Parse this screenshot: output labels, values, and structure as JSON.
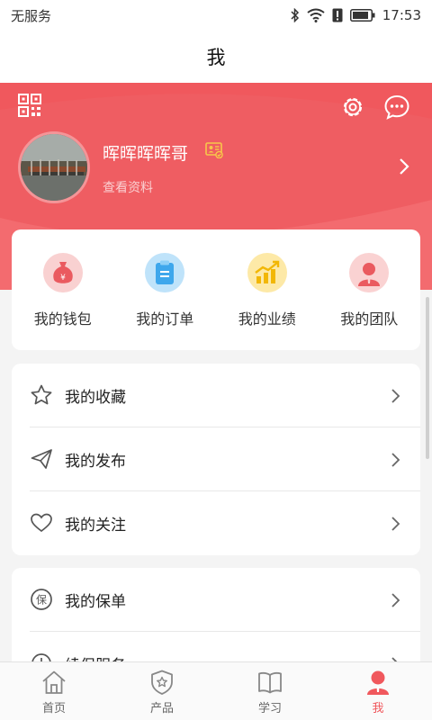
{
  "status_bar": {
    "carrier": "无服务",
    "time": "17:53"
  },
  "header": {
    "title": "我"
  },
  "profile": {
    "username": "晖晖晖晖哥",
    "view_profile": "查看资料"
  },
  "quick_actions": [
    {
      "label": "我的钱包",
      "icon": "wallet-icon",
      "color": "#f7c9c9"
    },
    {
      "label": "我的订单",
      "icon": "order-icon",
      "color": "#bfe3fa"
    },
    {
      "label": "我的业绩",
      "icon": "performance-icon",
      "color": "#fbe6a0"
    },
    {
      "label": "我的团队",
      "icon": "team-icon",
      "color": "#f9d0d0"
    }
  ],
  "menu_group_1": [
    {
      "label": "我的收藏",
      "icon": "star-icon"
    },
    {
      "label": "我的发布",
      "icon": "send-icon"
    },
    {
      "label": "我的关注",
      "icon": "heart-icon"
    }
  ],
  "menu_group_2": [
    {
      "label": "我的保单",
      "icon": "policy-icon"
    },
    {
      "label": "续保服务",
      "icon": "renewal-icon"
    }
  ],
  "tabbar": {
    "tabs": [
      {
        "label": "首页",
        "icon": "home-icon",
        "active": false
      },
      {
        "label": "产品",
        "icon": "product-icon",
        "active": false
      },
      {
        "label": "学习",
        "icon": "book-icon",
        "active": false
      },
      {
        "label": "我",
        "icon": "profile-icon",
        "active": true
      }
    ]
  },
  "colors": {
    "accent": "#f0585d",
    "background": "#f4f4f4"
  }
}
